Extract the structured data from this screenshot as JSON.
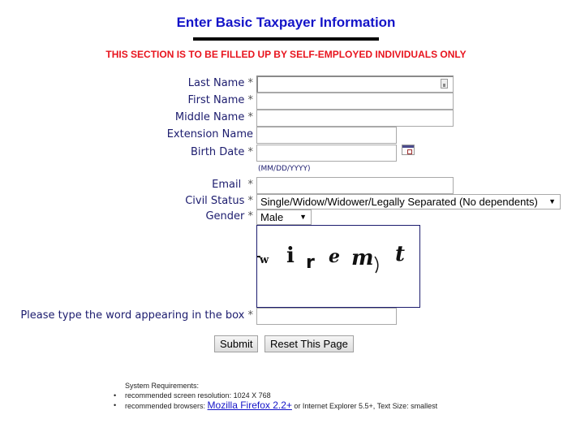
{
  "header": {
    "title": "Enter Basic Taxpayer Information",
    "notice": "THIS SECTION IS TO BE FILLED UP BY SELF-EMPLOYED INDIVIDUALS ONLY"
  },
  "form": {
    "last_name": {
      "label": "Last Name",
      "required_mark": "*",
      "value": ""
    },
    "first_name": {
      "label": "First Name",
      "required_mark": "*",
      "value": ""
    },
    "middle_name": {
      "label": "Middle Name",
      "required_mark": "*",
      "value": ""
    },
    "extension_name": {
      "label": "Extension Name",
      "value": ""
    },
    "birth_date": {
      "label": "Birth Date",
      "required_mark": "*",
      "value": "",
      "format_hint": "(MM/DD/YYYY)",
      "icon": "calendar-icon"
    },
    "email": {
      "label": "Email",
      "required_mark": "*",
      "value": ""
    },
    "civil_status": {
      "label": "Civil Status",
      "required_mark": "*",
      "selected": "Single/Widow/Widower/Legally Separated (No dependents)",
      "arrow": "▼"
    },
    "gender": {
      "label": "Gender",
      "required_mark": "*",
      "selected": "Male",
      "arrow": "▼"
    },
    "captcha": {
      "text": "wiremt",
      "label": "Please type the word appearing in the box",
      "required_mark": "*",
      "value": ""
    }
  },
  "buttons": {
    "submit": "Submit",
    "reset": "Reset This Page"
  },
  "system_requirements": {
    "heading": "System Requirements:",
    "resolution": "recommended screen resolution: 1024 X 768",
    "browsers_prefix": "recommended browsers: ",
    "browsers_link": "Mozilla Firefox 2.2+",
    "browsers_suffix": " or Internet Explorer 5.5+, Text Size: smallest"
  },
  "colors": {
    "title": "#1414c8",
    "notice": "#e8141e",
    "label": "#1c1c6e"
  }
}
